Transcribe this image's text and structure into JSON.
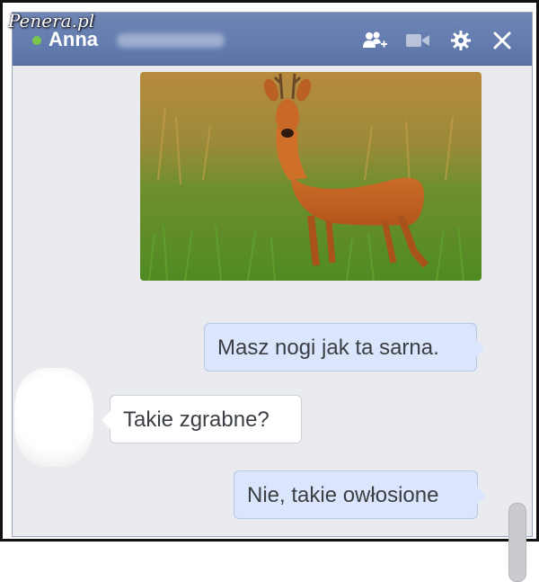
{
  "watermark": "Penera.pl",
  "header": {
    "contact_name": "Anna",
    "online": true,
    "icons": [
      "add-friend-icon",
      "video-call-icon",
      "gear-icon",
      "close-icon"
    ]
  },
  "messages": [
    {
      "type": "image",
      "from": "me",
      "content": "photo of a roe deer in a grassy field"
    },
    {
      "type": "text",
      "from": "me",
      "text": "Masz nogi jak ta sarna."
    },
    {
      "type": "text",
      "from": "them",
      "text": "Takie zgrabne?"
    },
    {
      "type": "text",
      "from": "me",
      "text": "Nie, takie owłosione"
    }
  ],
  "colors": {
    "header": "#5b74a8",
    "chat_background": "#e9ebee",
    "sent_bubble": "#dbe5fb",
    "received_bubble": "#ffffff",
    "online_status": "#7bc74d"
  }
}
